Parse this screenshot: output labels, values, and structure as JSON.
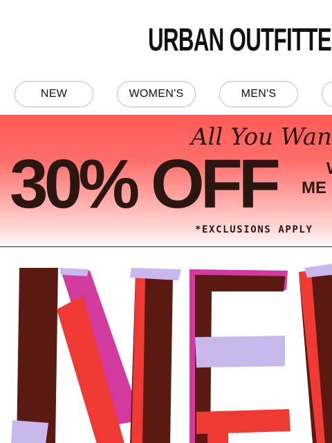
{
  "brand": {
    "logo_text": "URBAN OUTFITTERS"
  },
  "nav": {
    "items": [
      {
        "label": "NEW"
      },
      {
        "label": "WOMEN'S"
      },
      {
        "label": "MEN'S"
      },
      {
        "label": ""
      }
    ]
  },
  "promo": {
    "script_text": "All You Want",
    "headline": "30% OFF",
    "side_line1": "W",
    "side_line2": "ME",
    "note": "*EXCLUSIONS APPLY",
    "bg_top": "#ff5a57",
    "text_color": "#2a1712"
  },
  "hero": {
    "artwork_text": "NEW",
    "colors": {
      "maroon": "#5a1a12",
      "red": "#ef3a34",
      "magenta": "#d23aa0",
      "lavender": "#c9b8ee"
    }
  }
}
